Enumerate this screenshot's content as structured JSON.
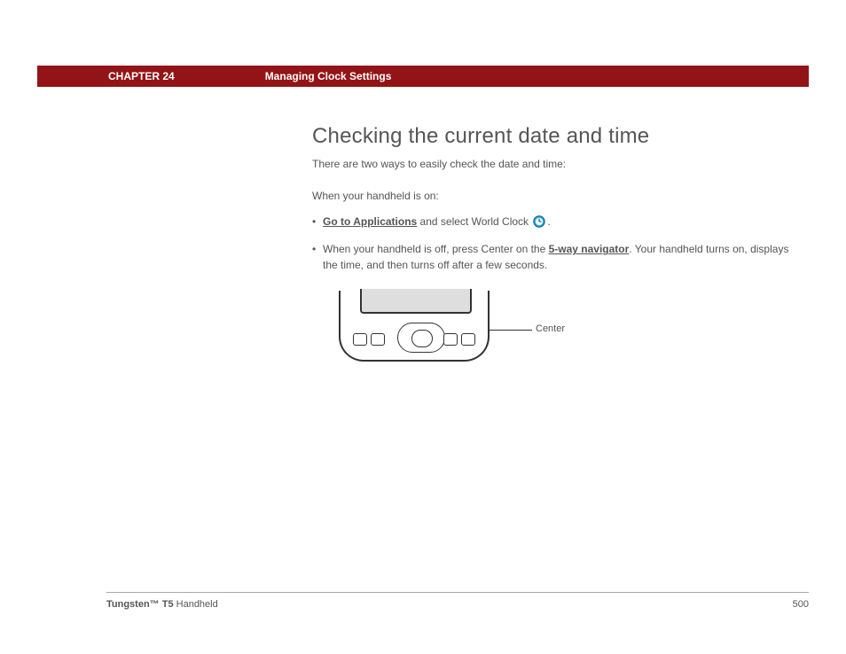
{
  "header": {
    "chapter": "CHAPTER 24",
    "section": "Managing Clock Settings"
  },
  "content": {
    "title": "Checking the current date and time",
    "intro": "There are two ways to easily check the date and time:",
    "when_on": "When your handheld is on:",
    "bullet1": {
      "link": "Go to Applications",
      "after_link": " and select World Clock ",
      "period": "."
    },
    "bullet2": {
      "pre": "When your handheld is off, press Center on the ",
      "link": "5-way navigator",
      "post": ". Your handheld turns on, displays the time, and then turns off after a few seconds."
    },
    "figure": {
      "callout": "Center"
    }
  },
  "footer": {
    "product_bold": "Tungsten™ T5",
    "product_rest": " Handheld",
    "page": "500"
  }
}
